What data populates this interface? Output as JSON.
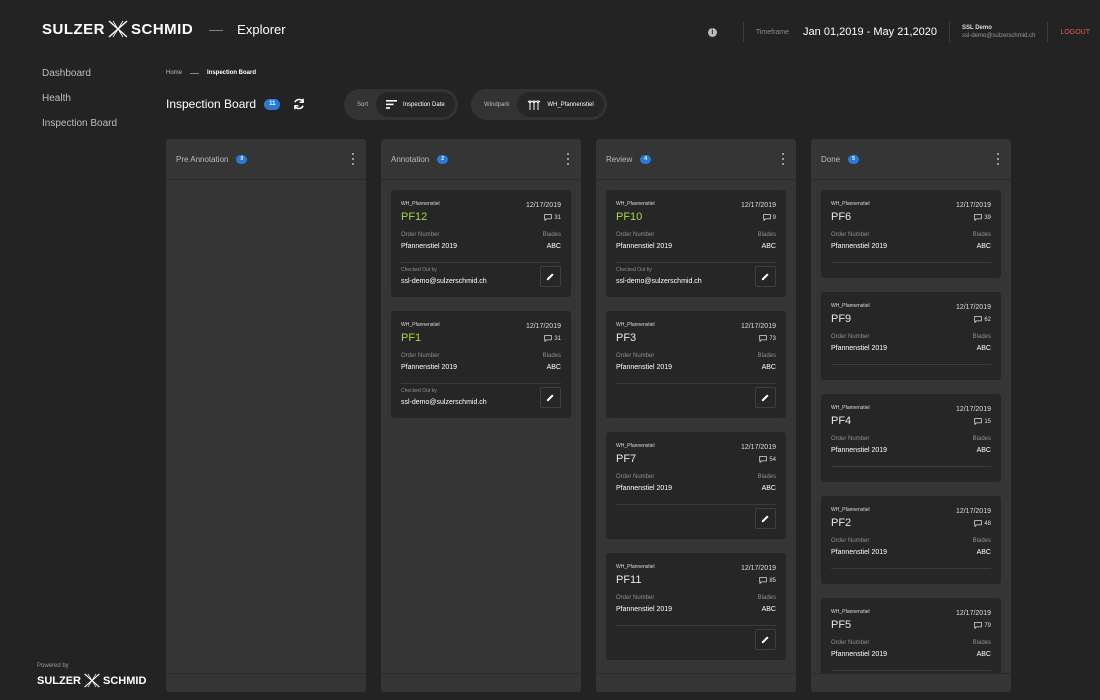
{
  "header": {
    "brand_left": "SULZER",
    "brand_right": "SCHMID",
    "separator": "—",
    "app_name": "Explorer",
    "timeframe_label": "Timeframe",
    "timeframe_value": "Jan 01,2019 - May 21,2020",
    "user_name": "SSL Demo",
    "user_email": "ssl-demo@sulzerschmid.ch",
    "logout": "LOGOUT",
    "info_icon": "info-icon"
  },
  "sidebar": {
    "items": [
      {
        "label": "Dashboard"
      },
      {
        "label": "Health"
      },
      {
        "label": "Inspection Board"
      }
    ],
    "powered_by": "Powered by",
    "footer_brand_left": "SULZER",
    "footer_brand_right": "SCHMID"
  },
  "breadcrumb": {
    "home": "Home",
    "current": "Inspection Board"
  },
  "page": {
    "title": "Inspection Board",
    "count": "11"
  },
  "sort": {
    "label": "Sort",
    "value": "Inspection Date",
    "icon": "sort-icon"
  },
  "windpark": {
    "label": "Windpark",
    "value": "WH_Pfannenstiel",
    "icon": "windpark-icon"
  },
  "colors": {
    "accent": "#2979d9",
    "green": "#a6d64a",
    "logout": "#e05a5a"
  },
  "columns": [
    {
      "title": "Pre Annotation",
      "count": "0",
      "cards": []
    },
    {
      "title": "Annotation",
      "count": "2",
      "cards": [
        {
          "park": "WH_Pfannenstiel",
          "date": "12/17/2019",
          "name": "PF12",
          "comments": "31",
          "order_label": "Order Number",
          "order": "Pfannenstiel 2019",
          "blades_label": "Blades",
          "blades": "ABC",
          "checked_out_label": "Checked Out by",
          "checked_out": "ssl-demo@sulzerschmid.ch",
          "highlight": true
        },
        {
          "park": "WH_Pfannenstiel",
          "date": "12/17/2019",
          "name": "PF1",
          "comments": "31",
          "order_label": "Order Number",
          "order": "Pfannenstiel 2019",
          "blades_label": "Blades",
          "blades": "ABC",
          "checked_out_label": "Checked Out by",
          "checked_out": "ssl-demo@sulzerschmid.ch",
          "highlight": true
        }
      ]
    },
    {
      "title": "Review",
      "count": "4",
      "cards": [
        {
          "park": "WH_Pfannenstiel",
          "date": "12/17/2019",
          "name": "PF10",
          "comments": "9",
          "order_label": "Order Number",
          "order": "Pfannenstiel 2019",
          "blades_label": "Blades",
          "blades": "ABC",
          "checked_out_label": "Checked Out by",
          "checked_out": "ssl-demo@sulzerschmid.ch",
          "highlight": true
        },
        {
          "park": "WH_Pfannenstiel",
          "date": "12/17/2019",
          "name": "PF3",
          "comments": "73",
          "order_label": "Order Number",
          "order": "Pfannenstiel 2019",
          "blades_label": "Blades",
          "blades": "ABC",
          "edit": true
        },
        {
          "park": "WH_Pfannenstiel",
          "date": "12/17/2019",
          "name": "PF7",
          "comments": "54",
          "order_label": "Order Number",
          "order": "Pfannenstiel 2019",
          "blades_label": "Blades",
          "blades": "ABC",
          "edit": true
        },
        {
          "park": "WH_Pfannenstiel",
          "date": "12/17/2019",
          "name": "PF11",
          "comments": "85",
          "order_label": "Order Number",
          "order": "Pfannenstiel 2019",
          "blades_label": "Blades",
          "blades": "ABC",
          "edit": true
        }
      ]
    },
    {
      "title": "Done",
      "count": "5",
      "cards": [
        {
          "park": "WH_Pfannenstiel",
          "date": "12/17/2019",
          "name": "PF6",
          "comments": "39",
          "order_label": "Order Number",
          "order": "Pfannenstiel 2019",
          "blades_label": "Blades",
          "blades": "ABC"
        },
        {
          "park": "WH_Pfannenstiel",
          "date": "12/17/2019",
          "name": "PF9",
          "comments": "62",
          "order_label": "Order Number",
          "order": "Pfannenstiel 2019",
          "blades_label": "Blades",
          "blades": "ABC"
        },
        {
          "park": "WH_Pfannenstiel",
          "date": "12/17/2019",
          "name": "PF4",
          "comments": "15",
          "order_label": "Order Number",
          "order": "Pfannenstiel 2019",
          "blades_label": "Blades",
          "blades": "ABC"
        },
        {
          "park": "WH_Pfannenstiel",
          "date": "12/17/2019",
          "name": "PF2",
          "comments": "48",
          "order_label": "Order Number",
          "order": "Pfannenstiel 2019",
          "blades_label": "Blades",
          "blades": "ABC"
        },
        {
          "park": "WH_Pfannenstiel",
          "date": "12/17/2019",
          "name": "PF5",
          "comments": "79",
          "order_label": "Order Number",
          "order": "Pfannenstiel 2019",
          "blades_label": "Blades",
          "blades": "ABC"
        }
      ]
    }
  ]
}
